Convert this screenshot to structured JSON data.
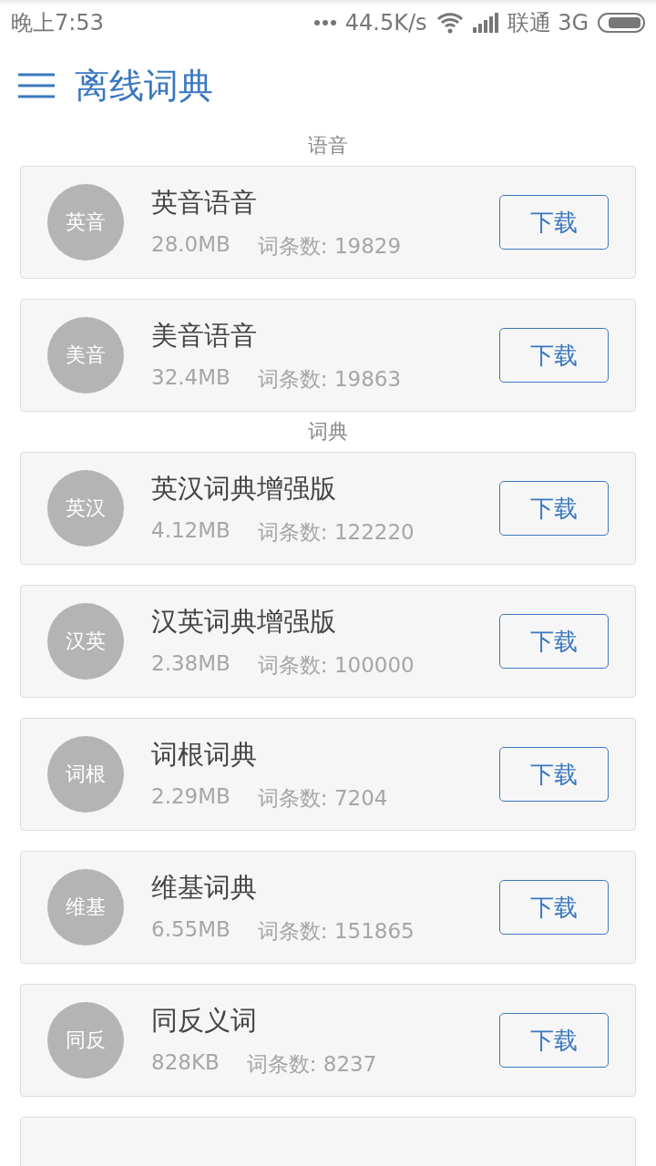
{
  "status_bar": {
    "time": "晚上7:53",
    "speed": "44.5K/s",
    "carrier": "联通 3G"
  },
  "header": {
    "title": "离线词典"
  },
  "sections": [
    {
      "title": "语音",
      "items": [
        {
          "badge": "英音",
          "name": "英音语音",
          "size": "28.0MB",
          "entries": "词条数: 19829",
          "action": "下载"
        },
        {
          "badge": "美音",
          "name": "美音语音",
          "size": "32.4MB",
          "entries": "词条数: 19863",
          "action": "下载"
        }
      ]
    },
    {
      "title": "词典",
      "items": [
        {
          "badge": "英汉",
          "name": "英汉词典增强版",
          "size": "4.12MB",
          "entries": "词条数: 122220",
          "action": "下载"
        },
        {
          "badge": "汉英",
          "name": "汉英词典增强版",
          "size": "2.38MB",
          "entries": "词条数: 100000",
          "action": "下载"
        },
        {
          "badge": "词根",
          "name": "词根词典",
          "size": "2.29MB",
          "entries": "词条数: 7204",
          "action": "下载"
        },
        {
          "badge": "维基",
          "name": "维基词典",
          "size": "6.55MB",
          "entries": "词条数: 151865",
          "action": "下载"
        },
        {
          "badge": "同反",
          "name": "同反义词",
          "size": "828KB",
          "entries": "词条数: 8237",
          "action": "下载"
        }
      ]
    }
  ]
}
